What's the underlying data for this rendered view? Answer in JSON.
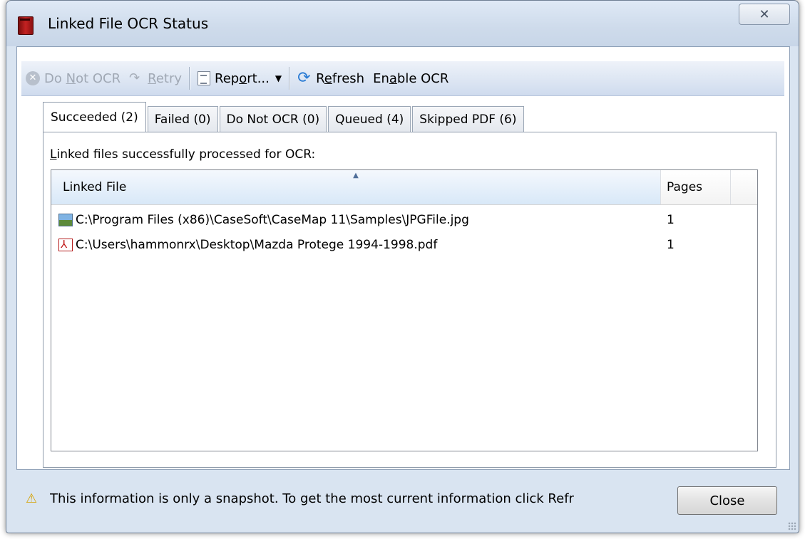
{
  "window": {
    "title": "Linked File OCR Status",
    "close_glyph": "✕"
  },
  "toolbar": {
    "do_not_ocr": {
      "pre": "Do ",
      "u": "N",
      "post": "ot OCR"
    },
    "retry": {
      "pre": "",
      "u": "R",
      "post": "etry"
    },
    "report": {
      "pre": "Rep",
      "u": "o",
      "post": "rt..."
    },
    "refresh": {
      "pre": "R",
      "u": "e",
      "post": "fresh"
    },
    "enable_ocr": {
      "pre": "En",
      "u": "a",
      "post": "ble OCR"
    },
    "dropdown_glyph": "▼"
  },
  "tabs": [
    {
      "label": "Succeeded (2)",
      "active": true
    },
    {
      "label": "Failed (0)",
      "active": false
    },
    {
      "label": "Do Not OCR (0)",
      "active": false
    },
    {
      "label": "Queued (4)",
      "active": false
    },
    {
      "label": "Skipped PDF (6)",
      "active": false
    }
  ],
  "panel": {
    "label_u": "L",
    "label_rest": "inked files successfully processed for OCR:"
  },
  "list": {
    "columns": {
      "file": "Linked File",
      "pages": "Pages"
    },
    "sort_glyph": "▲",
    "rows": [
      {
        "icon": "image-file-icon",
        "file": "C:\\Program Files (x86)\\CaseSoft\\CaseMap 11\\Samples\\JPGFile.jpg",
        "pages": "1"
      },
      {
        "icon": "pdf-file-icon",
        "file": "C:\\Users\\hammonrx\\Desktop\\Mazda Protege 1994-1998.pdf",
        "pages": "1"
      }
    ]
  },
  "footer": {
    "warning_glyph": "⚠",
    "message": "This information is only a snapshot.  To get the most current information click Refr",
    "close_label": "Close"
  },
  "colors": {
    "accent": "#2a7bd4",
    "warning": "#d6a200",
    "pdf_red": "#c01818"
  }
}
